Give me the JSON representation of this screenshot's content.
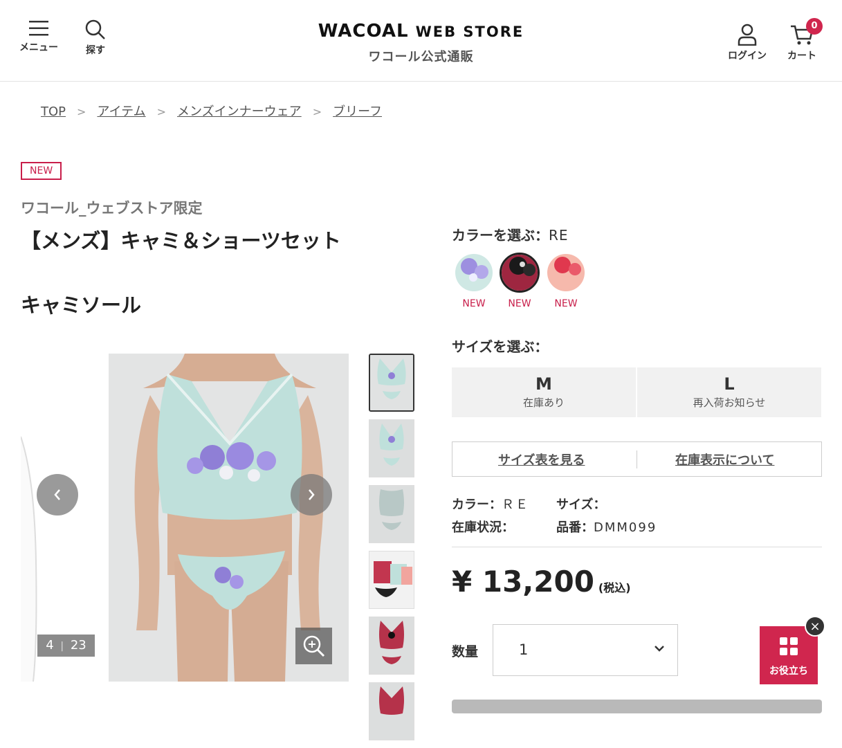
{
  "header": {
    "menu_label": "メニュー",
    "search_label": "探す",
    "logo_main": "WACOAL",
    "logo_sub": "WEB STORE",
    "logo_jp": "ワコール公式通販",
    "login_label": "ログイン",
    "cart_label": "カート",
    "cart_count": "0"
  },
  "breadcrumb": [
    "TOP",
    "アイテム",
    "メンズインナーウェア",
    "ブリーフ"
  ],
  "product": {
    "new_tag": "NEW",
    "brand": "ワコール_ウェブストア限定",
    "title": "【メンズ】キャミ＆ショーツセット",
    "subtitle": "キャミソール"
  },
  "gallery": {
    "counter_current": "4",
    "counter_sep": "|",
    "counter_total": "23"
  },
  "color": {
    "label": "カラーを選ぶ：",
    "selected": "RE",
    "swatches": [
      {
        "name": "mint-lavender",
        "tag": "NEW",
        "selected": false
      },
      {
        "name": "black-red",
        "tag": "NEW",
        "selected": true
      },
      {
        "name": "pink-coral",
        "tag": "NEW",
        "selected": false
      }
    ]
  },
  "size": {
    "label": "サイズを選ぶ：",
    "options": [
      {
        "size": "M",
        "status": "在庫あり"
      },
      {
        "size": "L",
        "status": "再入荷お知らせ"
      }
    ]
  },
  "links": {
    "size_chart": "サイズ表を見る",
    "stock_info": "在庫表示について"
  },
  "details": {
    "color_label": "カラー：",
    "color_value": "ＲＥ",
    "size_label": "サイズ：",
    "size_value": "",
    "stock_label": "在庫状況：",
    "stock_value": "",
    "sku_label": "品番：",
    "sku_value": "DMM099"
  },
  "price": {
    "amount": "¥ 13,200",
    "tax_note": "(税込)"
  },
  "quantity": {
    "label": "数量",
    "value": "1"
  },
  "helper": {
    "label": "お役立ち",
    "close": "×"
  },
  "colors": {
    "accent": "#d0264e",
    "new_red": "#c81e4a"
  }
}
